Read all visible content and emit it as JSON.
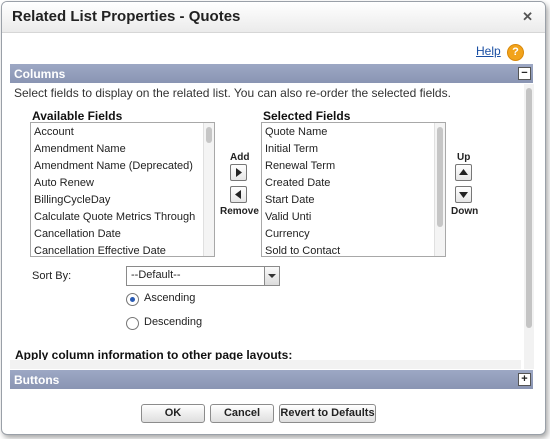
{
  "dialog": {
    "title": "Related List Properties - Quotes",
    "close_icon": "✕",
    "help_label": "Help",
    "help_icon": "?"
  },
  "columns_section": {
    "header": "Columns",
    "toggle": "−",
    "description": "Select fields to display on the related list. You can also re-order the selected fields.",
    "available_label": "Available Fields",
    "selected_label": "Selected Fields",
    "available_fields": [
      "Account",
      "Amendment Name",
      "Amendment Name (Deprecated)",
      "Auto Renew",
      "BillingCycleDay",
      "Calculate Quote Metrics Through",
      "Cancellation Date",
      "Cancellation Effective Date"
    ],
    "selected_fields": [
      "Quote Name",
      "Initial Term",
      "Renewal Term",
      "Created Date",
      "Start Date",
      "Valid Unti",
      "Currency",
      "Sold to Contact"
    ],
    "add_label": "Add",
    "remove_label": "Remove",
    "up_label": "Up",
    "down_label": "Down",
    "sort_by_label": "Sort By:",
    "sort_by_value": "--Default--",
    "ascending_label": "Ascending",
    "descending_label": "Descending",
    "sort_order": "Ascending",
    "apply_heading": "Apply column information to other page layouts:"
  },
  "buttons_section": {
    "header": "Buttons",
    "toggle": "+"
  },
  "footer": {
    "ok_label": "OK",
    "cancel_label": "Cancel",
    "revert_label": "Revert to Defaults"
  }
}
